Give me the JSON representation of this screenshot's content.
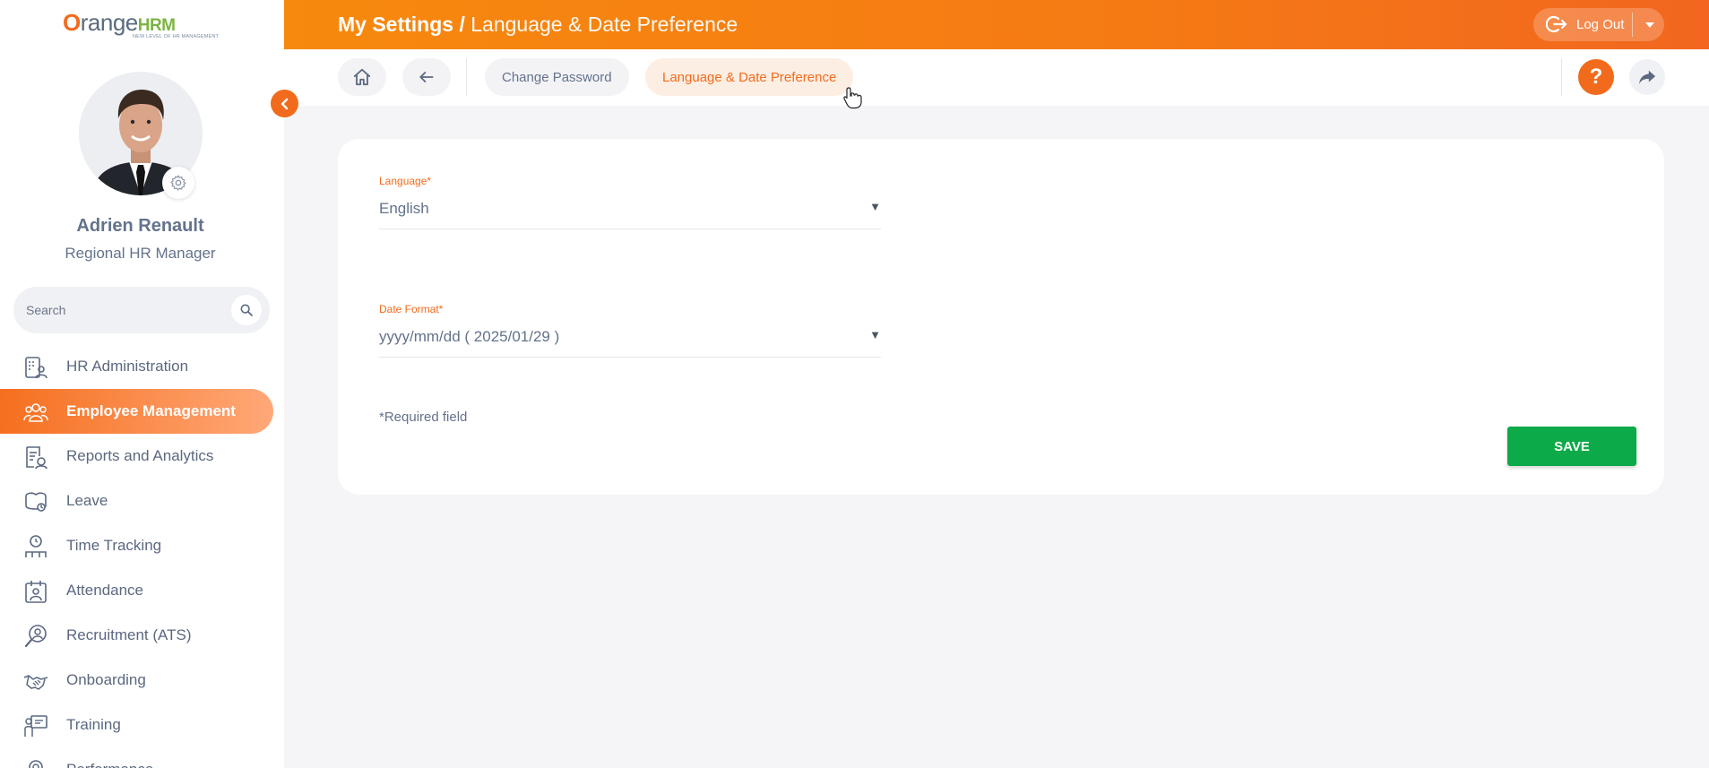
{
  "brand": {
    "logo_o": "O",
    "logo_range": "range",
    "logo_hrm": "HRM",
    "logo_tagline": "NEW LEVEL OF HR MANAGEMENT",
    "accent_color": "#f26b1d",
    "success_color": "#0caa48"
  },
  "header": {
    "title_main": "My Settings /",
    "title_sub": "Language & Date Preference",
    "logout_label": "Log Out"
  },
  "user": {
    "name": "Adrien Renault",
    "role": "Regional HR Manager"
  },
  "sidebar": {
    "search_placeholder": "Search",
    "items": [
      {
        "label": "HR Administration",
        "icon": "hr-admin-icon",
        "active": false
      },
      {
        "label": "Employee Management",
        "icon": "employee-management-icon",
        "active": true
      },
      {
        "label": "Reports and Analytics",
        "icon": "reports-icon",
        "active": false
      },
      {
        "label": "Leave",
        "icon": "leave-icon",
        "active": false
      },
      {
        "label": "Time Tracking",
        "icon": "time-tracking-icon",
        "active": false
      },
      {
        "label": "Attendance",
        "icon": "attendance-icon",
        "active": false
      },
      {
        "label": "Recruitment (ATS)",
        "icon": "recruitment-icon",
        "active": false
      },
      {
        "label": "Onboarding",
        "icon": "onboarding-icon",
        "active": false
      },
      {
        "label": "Training",
        "icon": "training-icon",
        "active": false
      },
      {
        "label": "Performance",
        "icon": "performance-icon",
        "active": false
      }
    ]
  },
  "subnav": {
    "tabs": [
      {
        "label": "Change Password",
        "active": false
      },
      {
        "label": "Language & Date Preference",
        "active": true
      }
    ],
    "help_label": "?"
  },
  "form": {
    "language": {
      "label": "Language*",
      "value": "English"
    },
    "date_format": {
      "label": "Date Format*",
      "value": "yyyy/mm/dd ( 2025/01/29 )"
    },
    "required_note": "*Required field",
    "save_label": "SAVE"
  }
}
